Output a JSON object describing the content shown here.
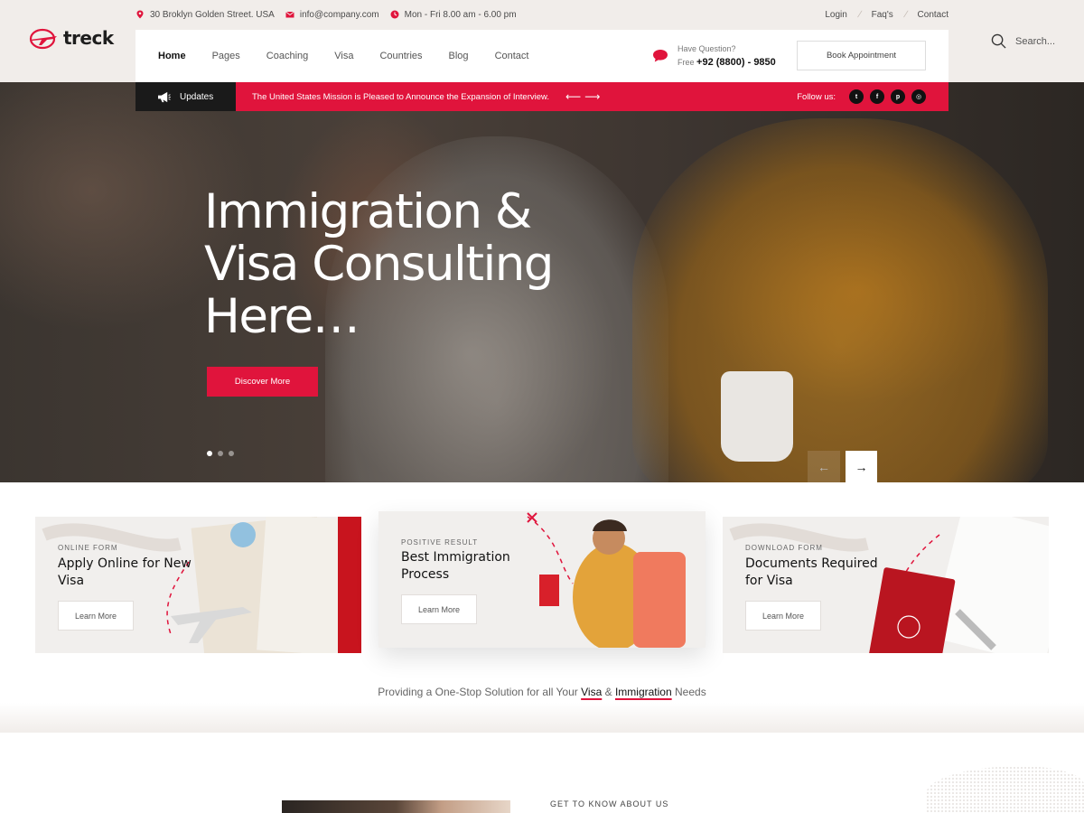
{
  "brand": {
    "name": "treck",
    "accent": "#e0143c",
    "dark": "#1a1a1a",
    "beige": "#f1edea"
  },
  "info_bar": {
    "address": "30 Broklyn Golden Street. USA",
    "email": "info@company.com",
    "hours": "Mon - Fri 8.00 am - 6.00 pm",
    "links": [
      "Login",
      "Faq's",
      "Contact"
    ]
  },
  "nav": {
    "items": [
      "Home",
      "Pages",
      "Coaching",
      "Visa",
      "Countries",
      "Blog",
      "Contact"
    ],
    "active": "Home",
    "question_label": "Have Question?",
    "free_label": "Free",
    "phone": "+92 (8800) - 9850",
    "book_button": "Book Appointment"
  },
  "search": {
    "placeholder": "Search..."
  },
  "updates": {
    "label": "Updates",
    "message": "The United States Mission is Pleased to Announce the Expansion of Interview.",
    "follow_label": "Follow us:",
    "socials": [
      "twitter-icon",
      "facebook-icon",
      "pinterest-icon",
      "instagram-icon"
    ]
  },
  "hero": {
    "title_line1": "Immigration &",
    "title_line2": "Visa Consulting",
    "title_line3": "Here…",
    "button": "Discover More",
    "slide_count": 3,
    "active_slide": 1
  },
  "cards": [
    {
      "kicker": "ONLINE FORM",
      "title": "Apply Online for New Visa",
      "button": "Learn More"
    },
    {
      "kicker": "POSITIVE RESULT",
      "title": "Best Immigration Process",
      "button": "Learn More"
    },
    {
      "kicker": "DOWNLOAD FORM",
      "title": "Documents Required for Visa",
      "button": "Learn More"
    }
  ],
  "tagline": {
    "before": "Providing a One-Stop Solution for all Your",
    "visa": "Visa",
    "amp": "&",
    "immigration": "Immigration",
    "after": "Needs"
  },
  "about": {
    "kicker": "GET TO KNOW ABOUT US"
  }
}
